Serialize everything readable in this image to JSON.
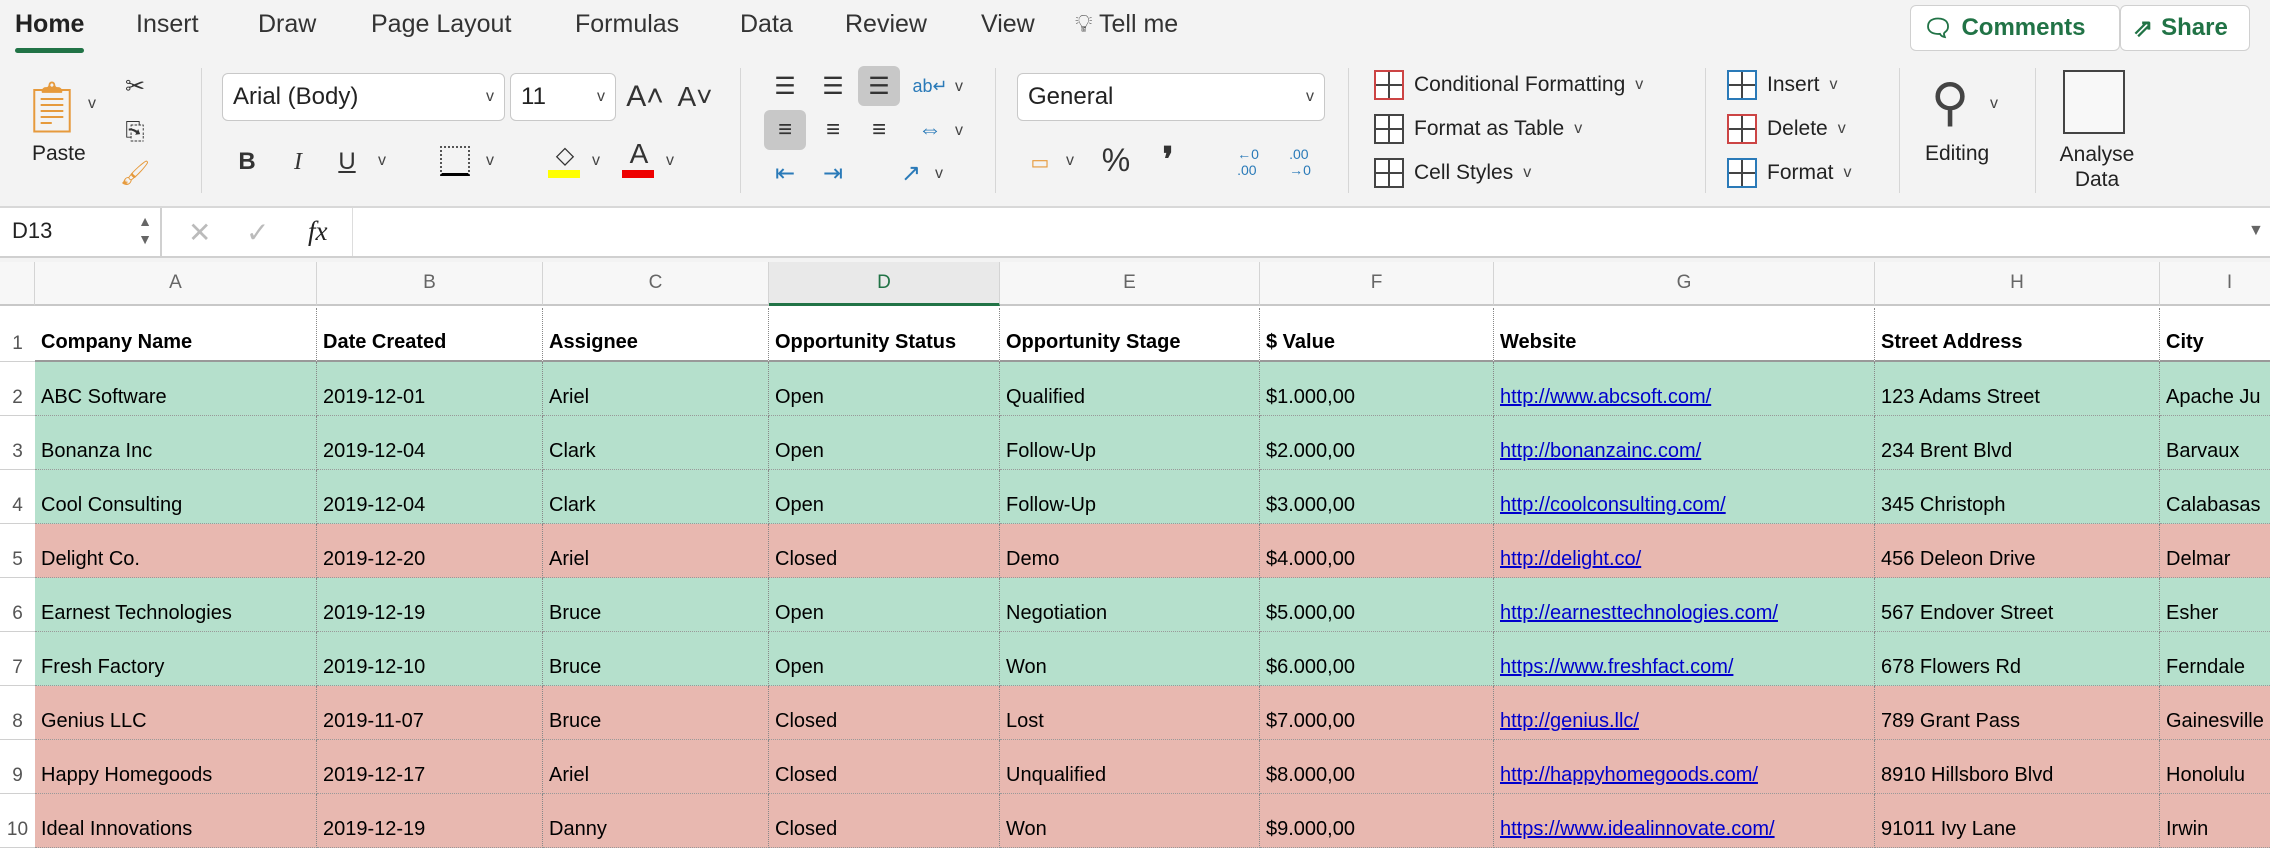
{
  "tabs": [
    "Home",
    "Insert",
    "Draw",
    "Page Layout",
    "Formulas",
    "Data",
    "Review",
    "View"
  ],
  "tell_me": "Tell me",
  "comments": "Comments",
  "share": "Share",
  "ribbon": {
    "paste": "Paste",
    "font_name": "Arial (Body)",
    "font_size": "11",
    "number_format": "General",
    "conditional_formatting": "Conditional Formatting",
    "format_as_table": "Format as Table",
    "cell_styles": "Cell Styles",
    "insert": "Insert",
    "delete": "Delete",
    "format": "Format",
    "editing": "Editing",
    "analyse_data": "Analyse Data",
    "bold": "B",
    "italic": "I",
    "underline": "U",
    "percent": "%",
    "comma": "❜",
    "fill_color": "#ffff00",
    "font_color": "#ee0000"
  },
  "formula_bar": {
    "name_box": "D13",
    "fx": "fx",
    "value": ""
  },
  "colors": {
    "open_row": "#b5e0cc",
    "closed_row": "#e8b8b0",
    "accent": "#217346"
  },
  "columns": [
    "A",
    "B",
    "C",
    "D",
    "E",
    "F",
    "G",
    "H",
    "I"
  ],
  "selected_column": "D",
  "headers": [
    "Company Name",
    "Date Created",
    "Assignee",
    "Opportunity Status",
    "Opportunity Stage",
    "$ Value",
    "Website",
    "Street Address",
    "City"
  ],
  "rows": [
    [
      "ABC Software",
      "2019-12-01",
      "Ariel",
      "Open",
      "Qualified",
      "$1.000,00",
      "http://www.abcsoft.com/",
      "123 Adams Street",
      "Apache Ju"
    ],
    [
      "Bonanza Inc",
      "2019-12-04",
      "Clark",
      "Open",
      "Follow-Up",
      "$2.000,00",
      "http://bonanzainc.com/",
      "234 Brent Blvd",
      "Barvaux"
    ],
    [
      "Cool Consulting",
      "2019-12-04",
      "Clark",
      "Open",
      "Follow-Up",
      "$3.000,00",
      "http://coolconsulting.com/",
      "345 Christoph",
      "Calabasas"
    ],
    [
      "Delight Co.",
      "2019-12-20",
      "Ariel",
      "Closed",
      "Demo",
      "$4.000,00",
      "http://delight.co/",
      "456 Deleon Drive",
      "Delmar"
    ],
    [
      "Earnest Technologies",
      "2019-12-19",
      "Bruce",
      "Open",
      "Negotiation",
      "$5.000,00",
      "http://earnesttechnologies.com/",
      "567 Endover Street",
      "Esher"
    ],
    [
      "Fresh Factory",
      "2019-12-10",
      "Bruce",
      "Open",
      "Won",
      "$6.000,00",
      "https://www.freshfact.com/",
      "678 Flowers Rd",
      "Ferndale"
    ],
    [
      "Genius LLC",
      "2019-11-07",
      "Bruce",
      "Closed",
      "Lost",
      "$7.000,00",
      "http://genius.llc/",
      "789 Grant Pass",
      "Gainesville"
    ],
    [
      "Happy Homegoods",
      "2019-12-17",
      "Ariel",
      "Closed",
      "Unqualified",
      "$8.000,00",
      "http://happyhomegoods.com/",
      "8910 Hillsboro Blvd",
      "Honolulu"
    ],
    [
      "Ideal Innovations",
      "2019-12-19",
      "Danny",
      "Closed",
      "Won",
      "$9.000,00",
      "https://www.idealinnovate.com/",
      "91011 Ivy Lane",
      "Irwin"
    ]
  ]
}
